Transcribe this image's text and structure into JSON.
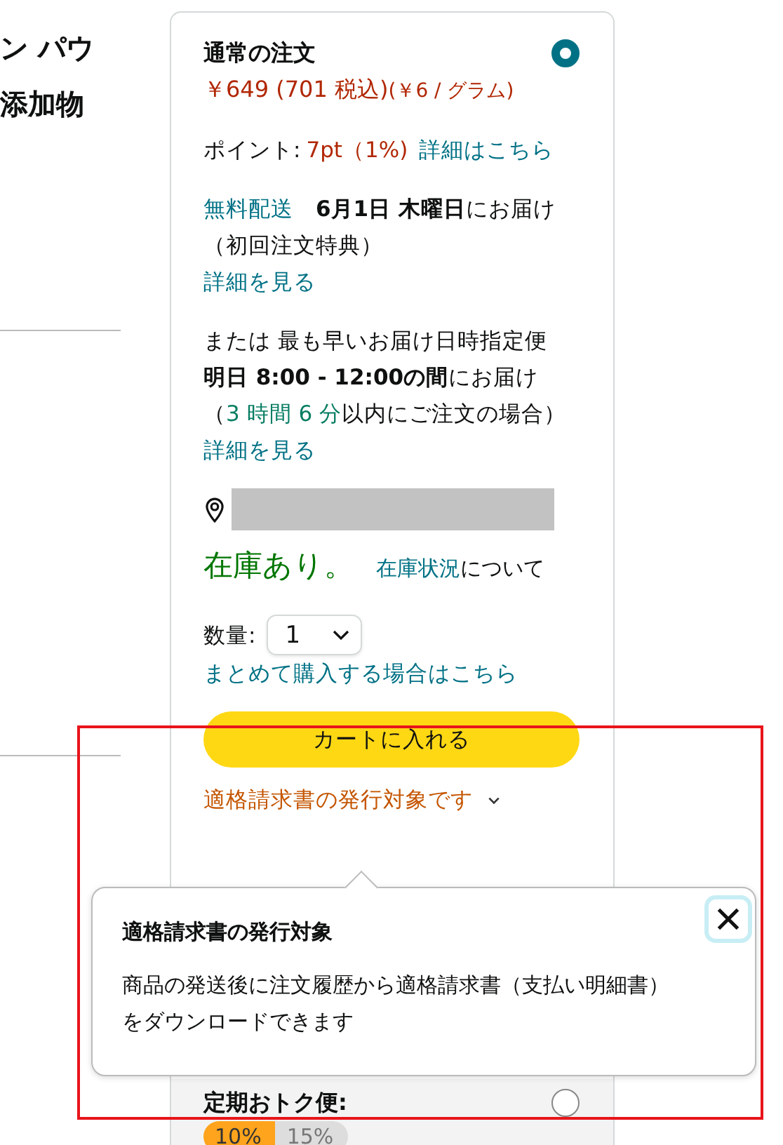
{
  "left_panel": {
    "title_lines": [
      "ン パウ",
      "添加物"
    ]
  },
  "offer": {
    "title": "通常の注文",
    "selected": true,
    "price": "￥649 (701 税込)",
    "unit_price": "(￥6 / グラム)",
    "points": {
      "label": "ポイント:",
      "value": "7pt（1%)",
      "link": "詳細はこちら"
    },
    "delivery": [
      {
        "text": "無料配送",
        "kind": "link"
      },
      {
        "text": "　6月1日 木曜日",
        "kind": "bold"
      },
      {
        "text": "にお届け（初回注文特典）",
        "kind": "plain"
      }
    ],
    "delivery_details": "詳細を見る",
    "fastest": [
      {
        "text": "または 最も早いお届け日時指定便　",
        "kind": "plain"
      },
      {
        "text": "明日 8:00 - 12:00の間",
        "kind": "bold"
      },
      {
        "text": "にお届け（",
        "kind": "plain"
      },
      {
        "text": "3 時間 6 分",
        "kind": "green"
      },
      {
        "text": "以内にご注文の場合）",
        "kind": "plain"
      }
    ],
    "fastest_details": "詳細を見る",
    "stock": {
      "status": "在庫あり。",
      "link": "在庫状況",
      "suffix": "について"
    },
    "quantity": {
      "label": "数量:",
      "value": "1"
    },
    "bulk_link": "まとめて購入する場合はこちら",
    "cart_button": "カートに入れる",
    "invoice": {
      "label": "適格請求書の発行対象です",
      "expanded": true
    }
  },
  "popover": {
    "title": "適格請求書の発行対象",
    "body": "商品の発送後に注文履歴から適格請求書（支払い明細書）をダウンロードできます"
  },
  "subscription": {
    "title": "定期おトク便:",
    "selected": false,
    "tiers": [
      {
        "label": "10%",
        "selected": true
      },
      {
        "label": "15%",
        "selected": false
      }
    ]
  }
}
